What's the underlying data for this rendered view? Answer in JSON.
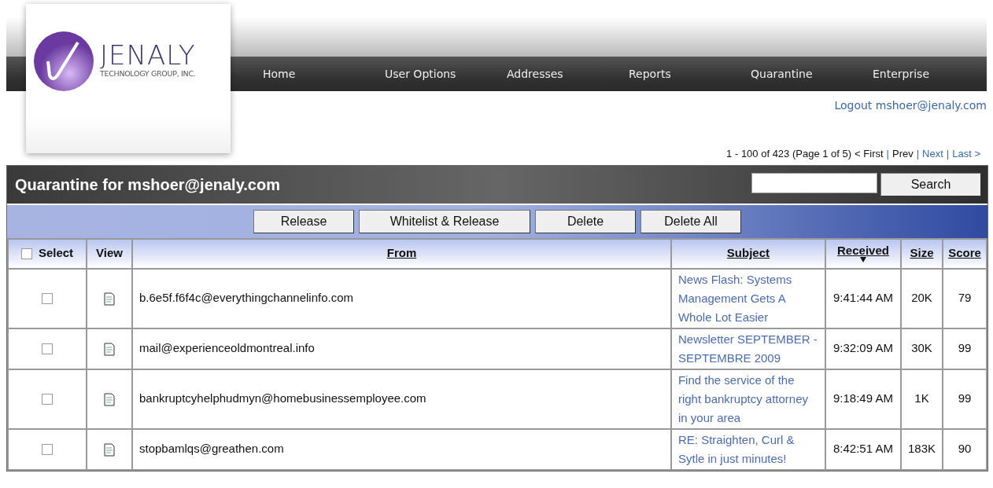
{
  "logo": {
    "name": "JENALY",
    "tagline": "TECHNOLOGY GROUP, INC."
  },
  "nav": [
    "Home",
    "User Options",
    "Addresses",
    "Reports",
    "Quarantine",
    "Enterprise"
  ],
  "logout": "Logout mshoer@jenaly.com",
  "pager": {
    "summary": "1 - 100 of 423 (Page 1 of 5)",
    "separator": "|",
    "links": [
      {
        "label": "< First",
        "disabled": true
      },
      {
        "label": "Prev",
        "disabled": true
      },
      {
        "label": "Next",
        "disabled": false
      },
      {
        "label": "Last >",
        "disabled": false
      }
    ]
  },
  "panel": {
    "title": "Quarantine for mshoer@jenaly.com",
    "search_button": "Search"
  },
  "actions": [
    "Release",
    "Whitelist & Release",
    "Delete",
    "Delete All"
  ],
  "table": {
    "select_all": {
      "label": "Select",
      "checked": false
    },
    "columns": [
      {
        "label": "View",
        "sortable": false,
        "sorted": false
      },
      {
        "label": "From",
        "sortable": true,
        "sorted": false
      },
      {
        "label": "Subject",
        "sortable": true,
        "sorted": false
      },
      {
        "label": "Received",
        "sortable": true,
        "sorted": true
      },
      {
        "label": "Size",
        "sortable": true,
        "sorted": false
      },
      {
        "label": "Score",
        "sortable": true,
        "sorted": false
      }
    ],
    "rows": [
      {
        "checked": false,
        "from": "b.6e5f.f6f4c@everythingchannelinfo.com",
        "subject": "News Flash: Systems Management Gets A Whole Lot Easier",
        "received": "9:41:44 AM",
        "size": "20K",
        "score": "79"
      },
      {
        "checked": false,
        "from": "mail@experienceoldmontreal.info",
        "subject": "Newsletter SEPTEMBER - SEPTEMBRE 2009",
        "received": "9:32:09 AM",
        "size": "30K",
        "score": "99"
      },
      {
        "checked": false,
        "from": "bankruptcyhelphudmyn@homebusinessemployee.com",
        "subject": "Find the service of the right bankruptcy attorney in your area",
        "received": "9:18:49 AM",
        "size": "1K",
        "score": "99"
      },
      {
        "checked": false,
        "from": "stopbamlqs@greathen.com",
        "subject": "RE: Straighten, Curl & Sytle in just minutes!",
        "received": "8:42:51 AM",
        "size": "183K",
        "score": "90"
      }
    ]
  }
}
